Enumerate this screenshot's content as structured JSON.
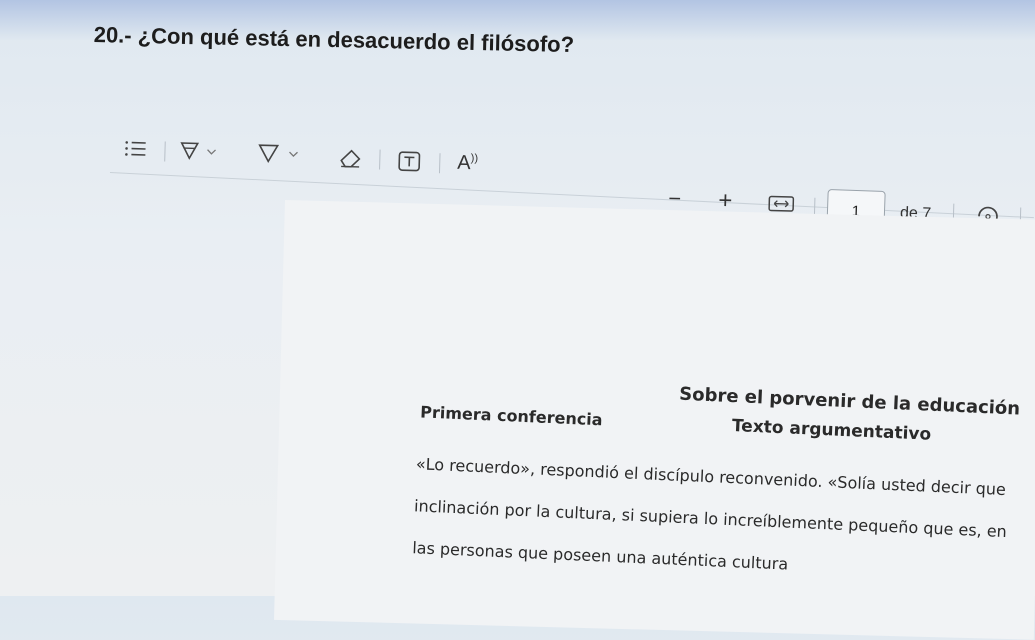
{
  "question": "20.- ¿Con qué está en desacuerdo el filósofo?",
  "toolbar": {
    "icons": [
      "list-icon",
      "highlight-icon",
      "draw-icon",
      "eraser-icon",
      "text-box-icon",
      "read-aloud-icon",
      "zoom-out-icon",
      "zoom-in-icon",
      "fit-width-icon",
      "rotate-icon"
    ],
    "page_current": "1",
    "page_total": "de 7"
  },
  "document": {
    "title": "Sobre el porvenir de la educación",
    "subtitle": "Texto argumentativo",
    "section": "Primera conferencia",
    "lines": [
      "«Lo recuerdo», respondió el discípulo reconvenido. «Solía usted decir que",
      "inclinación por la cultura, si supiera lo increíblemente pequeño que es, en",
      "las personas que poseen una auténtica cultura"
    ]
  }
}
